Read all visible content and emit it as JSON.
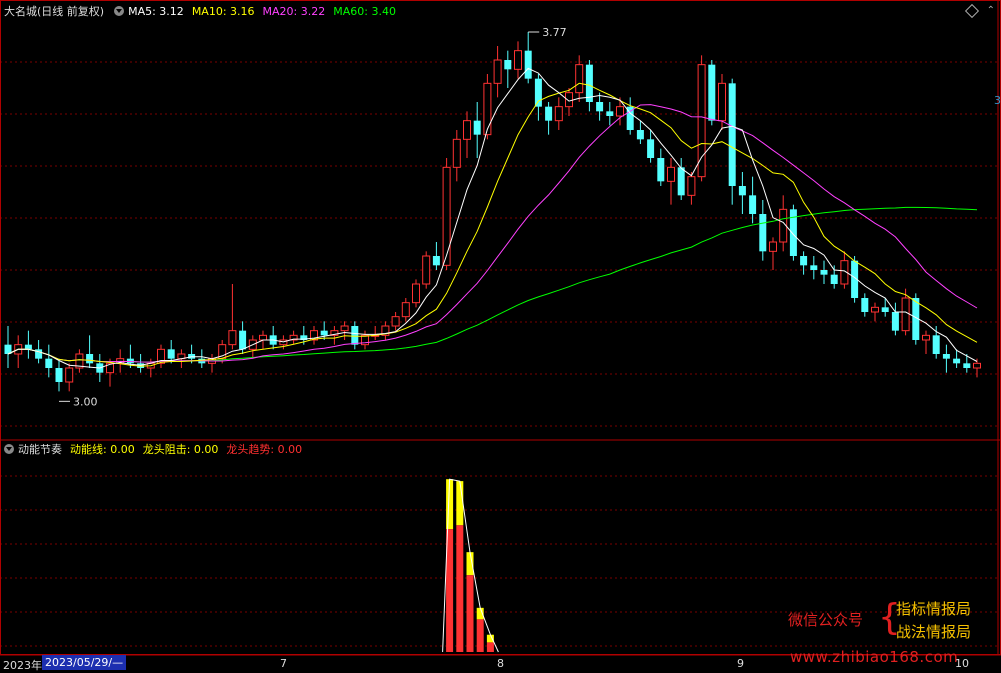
{
  "header": {
    "stock_title": "大名城(日线 前复权)",
    "ma": [
      {
        "label": "MA5: 3.12",
        "color": "#ffffff"
      },
      {
        "label": "MA10: 3.16",
        "color": "#ffff00"
      },
      {
        "label": "MA20: 3.22",
        "color": "#ff40ff"
      },
      {
        "label": "MA60: 3.40",
        "color": "#00ff00"
      }
    ]
  },
  "indicator": {
    "name": "动能节奏",
    "fields": [
      {
        "label": "动能线: 0.00",
        "color": "#ffff00"
      },
      {
        "label": "龙头阻击: 0.00",
        "color": "#ffff00"
      },
      {
        "label": "龙头趋势: 0.00",
        "color": "#ff3030"
      }
    ]
  },
  "annotations": {
    "high": "3.77",
    "low": "3.00"
  },
  "right_edge_label": "3",
  "date_axis": {
    "start": "2023年",
    "current": "2023/05/29/—",
    "ticks": [
      "7",
      "8",
      "9",
      "10"
    ]
  },
  "watermark": {
    "left": "微信公众号",
    "right_top": "指标情报局",
    "right_bottom": "战法情报局",
    "site": "www.zhibiao168.com"
  },
  "colors": {
    "up": "#ff3232",
    "down": "#54ffff",
    "ma5": "#ffffff",
    "ma10": "#ffff00",
    "ma20": "#ff40ff",
    "ma60": "#00ff00",
    "grid": "#7a0000",
    "frame": "#b00000"
  },
  "chart_data": {
    "type": "candlestick",
    "y_axis": {
      "min": 2.9,
      "max": 3.8
    },
    "high_mark": 3.77,
    "low_mark": 3.0,
    "candles_ohlc": [
      [
        3.1,
        3.14,
        3.05,
        3.08
      ],
      [
        3.08,
        3.12,
        3.05,
        3.1
      ],
      [
        3.1,
        3.13,
        3.07,
        3.09
      ],
      [
        3.09,
        3.11,
        3.06,
        3.07
      ],
      [
        3.07,
        3.1,
        3.03,
        3.05
      ],
      [
        3.05,
        3.07,
        3.0,
        3.02
      ],
      [
        3.02,
        3.06,
        3.0,
        3.05
      ],
      [
        3.05,
        3.09,
        3.04,
        3.08
      ],
      [
        3.08,
        3.12,
        3.05,
        3.06
      ],
      [
        3.06,
        3.08,
        3.02,
        3.04
      ],
      [
        3.04,
        3.07,
        3.01,
        3.06
      ],
      [
        3.06,
        3.09,
        3.04,
        3.07
      ],
      [
        3.07,
        3.1,
        3.05,
        3.06
      ],
      [
        3.06,
        3.08,
        3.04,
        3.05
      ],
      [
        3.05,
        3.07,
        3.03,
        3.06
      ],
      [
        3.06,
        3.1,
        3.05,
        3.09
      ],
      [
        3.09,
        3.11,
        3.06,
        3.07
      ],
      [
        3.07,
        3.09,
        3.05,
        3.08
      ],
      [
        3.08,
        3.1,
        3.06,
        3.07
      ],
      [
        3.07,
        3.09,
        3.05,
        3.06
      ],
      [
        3.06,
        3.08,
        3.04,
        3.07
      ],
      [
        3.07,
        3.11,
        3.06,
        3.1
      ],
      [
        3.1,
        3.23,
        3.09,
        3.13
      ],
      [
        3.13,
        3.15,
        3.08,
        3.09
      ],
      [
        3.09,
        3.12,
        3.07,
        3.11
      ],
      [
        3.11,
        3.13,
        3.09,
        3.12
      ],
      [
        3.12,
        3.14,
        3.09,
        3.1
      ],
      [
        3.1,
        3.12,
        3.09,
        3.11
      ],
      [
        3.11,
        3.13,
        3.1,
        3.12
      ],
      [
        3.12,
        3.14,
        3.1,
        3.11
      ],
      [
        3.11,
        3.14,
        3.1,
        3.13
      ],
      [
        3.13,
        3.15,
        3.11,
        3.12
      ],
      [
        3.12,
        3.14,
        3.1,
        3.13
      ],
      [
        3.13,
        3.15,
        3.11,
        3.14
      ],
      [
        3.14,
        3.15,
        3.09,
        3.1
      ],
      [
        3.1,
        3.13,
        3.09,
        3.12
      ],
      [
        3.12,
        3.14,
        3.11,
        3.12
      ],
      [
        3.12,
        3.15,
        3.11,
        3.14
      ],
      [
        3.14,
        3.17,
        3.13,
        3.16
      ],
      [
        3.16,
        3.2,
        3.15,
        3.19
      ],
      [
        3.19,
        3.24,
        3.18,
        3.23
      ],
      [
        3.23,
        3.3,
        3.22,
        3.29
      ],
      [
        3.29,
        3.32,
        3.26,
        3.27
      ],
      [
        3.27,
        3.5,
        3.26,
        3.48
      ],
      [
        3.48,
        3.56,
        3.45,
        3.54
      ],
      [
        3.54,
        3.6,
        3.5,
        3.58
      ],
      [
        3.58,
        3.62,
        3.5,
        3.55
      ],
      [
        3.55,
        3.68,
        3.54,
        3.66
      ],
      [
        3.66,
        3.74,
        3.63,
        3.71
      ],
      [
        3.71,
        3.73,
        3.65,
        3.69
      ],
      [
        3.69,
        3.75,
        3.67,
        3.73
      ],
      [
        3.73,
        3.77,
        3.66,
        3.67
      ],
      [
        3.67,
        3.68,
        3.58,
        3.61
      ],
      [
        3.61,
        3.62,
        3.55,
        3.58
      ],
      [
        3.58,
        3.63,
        3.56,
        3.61
      ],
      [
        3.61,
        3.65,
        3.59,
        3.64
      ],
      [
        3.64,
        3.72,
        3.62,
        3.7
      ],
      [
        3.7,
        3.71,
        3.6,
        3.62
      ],
      [
        3.62,
        3.64,
        3.58,
        3.6
      ],
      [
        3.6,
        3.62,
        3.57,
        3.59
      ],
      [
        3.59,
        3.63,
        3.57,
        3.61
      ],
      [
        3.61,
        3.63,
        3.55,
        3.56
      ],
      [
        3.56,
        3.58,
        3.53,
        3.54
      ],
      [
        3.54,
        3.56,
        3.49,
        3.5
      ],
      [
        3.5,
        3.52,
        3.44,
        3.45
      ],
      [
        3.45,
        3.5,
        3.4,
        3.48
      ],
      [
        3.48,
        3.5,
        3.41,
        3.42
      ],
      [
        3.42,
        3.47,
        3.4,
        3.46
      ],
      [
        3.46,
        3.72,
        3.45,
        3.7
      ],
      [
        3.7,
        3.71,
        3.57,
        3.58
      ],
      [
        3.58,
        3.68,
        3.56,
        3.66
      ],
      [
        3.66,
        3.67,
        3.4,
        3.44
      ],
      [
        3.44,
        3.47,
        3.38,
        3.42
      ],
      [
        3.42,
        3.46,
        3.36,
        3.38
      ],
      [
        3.38,
        3.41,
        3.28,
        3.3
      ],
      [
        3.3,
        3.33,
        3.26,
        3.32
      ],
      [
        3.32,
        3.42,
        3.3,
        3.39
      ],
      [
        3.39,
        3.4,
        3.28,
        3.29
      ],
      [
        3.29,
        3.3,
        3.25,
        3.27
      ],
      [
        3.27,
        3.29,
        3.24,
        3.26
      ],
      [
        3.26,
        3.28,
        3.23,
        3.25
      ],
      [
        3.25,
        3.27,
        3.22,
        3.23
      ],
      [
        3.23,
        3.3,
        3.22,
        3.28
      ],
      [
        3.28,
        3.29,
        3.19,
        3.2
      ],
      [
        3.2,
        3.21,
        3.16,
        3.17
      ],
      [
        3.17,
        3.19,
        3.15,
        3.18
      ],
      [
        3.18,
        3.2,
        3.16,
        3.17
      ],
      [
        3.17,
        3.19,
        3.12,
        3.13
      ],
      [
        3.13,
        3.22,
        3.12,
        3.2
      ],
      [
        3.2,
        3.21,
        3.1,
        3.11
      ],
      [
        3.11,
        3.13,
        3.08,
        3.12
      ],
      [
        3.12,
        3.14,
        3.07,
        3.08
      ],
      [
        3.08,
        3.1,
        3.04,
        3.07
      ],
      [
        3.07,
        3.09,
        3.05,
        3.06
      ],
      [
        3.06,
        3.08,
        3.04,
        3.05
      ],
      [
        3.05,
        3.07,
        3.03,
        3.06
      ]
    ],
    "ma_windows": {
      "ma5": 5,
      "ma10": 10,
      "ma20": 20,
      "ma60": 60
    },
    "indicator_bars": {
      "start_index": 43,
      "red": [
        0.64,
        0.66,
        0.4,
        0.17,
        0.05
      ],
      "yellow": [
        0.9,
        0.89,
        0.52,
        0.23,
        0.09
      ]
    }
  }
}
